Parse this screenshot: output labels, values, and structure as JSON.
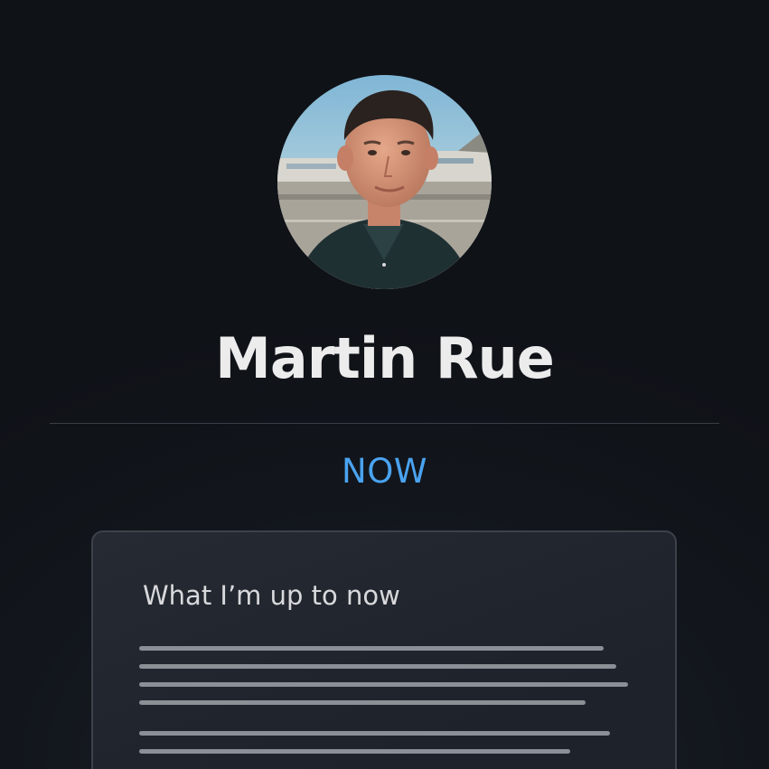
{
  "profile": {
    "name": "Martin Rue",
    "avatar_alt": "profile photo"
  },
  "section": {
    "tag": "NOW"
  },
  "card": {
    "title": "What I’m up to now"
  },
  "colors": {
    "background": "#101318",
    "accent": "#4aa3f0",
    "text": "#ececec",
    "card_border": "#3c414a",
    "placeholder_line": "#8b8f96"
  }
}
